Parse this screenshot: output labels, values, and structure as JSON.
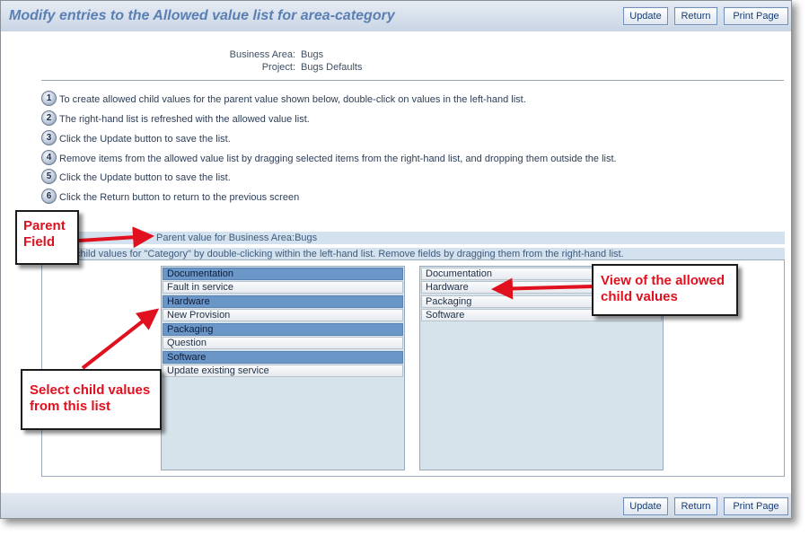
{
  "header": {
    "title": "Modify entries to the Allowed value list for area-category",
    "buttons": {
      "update": "Update",
      "return": "Return",
      "print": "Print Page"
    }
  },
  "footer": {
    "buttons": {
      "update": "Update",
      "return": "Return",
      "print": "Print Page"
    }
  },
  "context": {
    "business_area_label": "Business Area:",
    "business_area_value": "Bugs",
    "project_label": "Project:",
    "project_value": "Bugs Defaults"
  },
  "steps": [
    {
      "num": "1",
      "text": "To create allowed child values for the parent value shown below, double-click on values in the left-hand list."
    },
    {
      "num": "2",
      "text": "The right-hand list is refreshed with the allowed value list."
    },
    {
      "num": "3",
      "text": "Click the Update button to save the list."
    },
    {
      "num": "4",
      "text": "Remove items from the allowed value list by dragging selected items from the right-hand list, and dropping them outside the list."
    },
    {
      "num": "5",
      "text": "Click the Update button to save the list."
    },
    {
      "num": "6",
      "text": "Click the Return button to return to the previous screen"
    }
  ],
  "parent_section": {
    "text": "Parent value for Business Area:Bugs"
  },
  "child_section": {
    "text": "child values for \"Category\" by double-clicking within the left-hand list. Remove fields by dragging them from the right-hand list."
  },
  "left_list": {
    "items": [
      {
        "label": "Documentation",
        "selected": true
      },
      {
        "label": "Fault in service",
        "selected": false
      },
      {
        "label": "Hardware",
        "selected": true
      },
      {
        "label": "New Provision",
        "selected": false
      },
      {
        "label": "Packaging",
        "selected": true
      },
      {
        "label": "Question",
        "selected": false
      },
      {
        "label": "Software",
        "selected": true
      },
      {
        "label": "Update existing service",
        "selected": false
      }
    ]
  },
  "right_list": {
    "items": [
      {
        "label": "Documentation"
      },
      {
        "label": "Hardware"
      },
      {
        "label": "Packaging"
      },
      {
        "label": "Software"
      }
    ]
  },
  "callouts": {
    "parent_field": {
      "line1": "Parent",
      "line2": "Field"
    },
    "view_allowed": {
      "line1": "View of the allowed",
      "line2": "child values"
    },
    "select_child": {
      "line1": "Select child values",
      "line2": "from this list"
    }
  },
  "colors": {
    "title": "#5a7fb3",
    "selected_item": "#6b96c8",
    "list_background": "#d7e3eb",
    "callout_text": "#e0101e",
    "arrow": "#e0101e"
  }
}
